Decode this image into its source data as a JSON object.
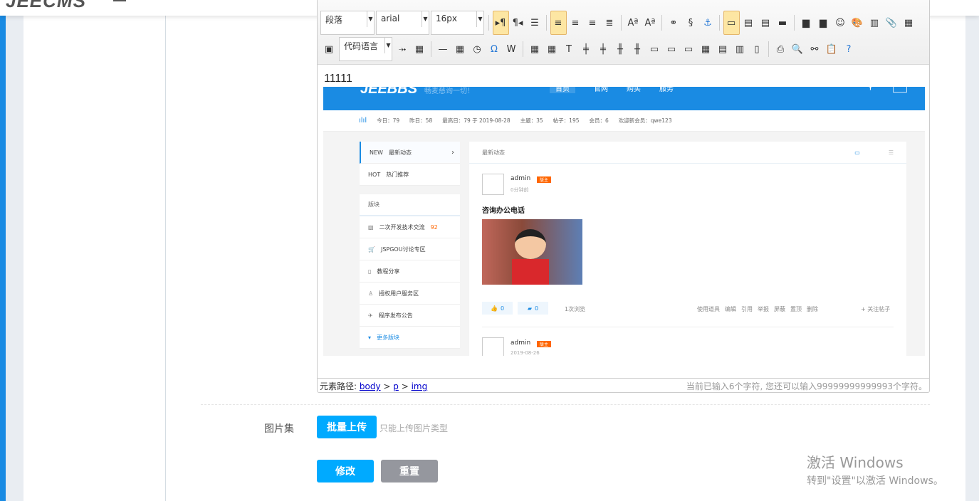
{
  "app": {
    "logo": "JEECMS"
  },
  "editor": {
    "toolbar": {
      "paragraph_select": "段落",
      "font_select": "arial",
      "size_select": "16px",
      "code_lang_select": "代码语言",
      "row1_icons": [
        [
          "ltr-direction-icon",
          "▸¶",
          true
        ],
        [
          "rtl-direction-icon",
          "¶◂",
          false
        ],
        [
          "indent-icon",
          "☰",
          false
        ],
        [
          "sep"
        ],
        [
          "align-left-icon",
          "≡",
          true
        ],
        [
          "align-center-icon",
          "≡",
          false
        ],
        [
          "align-right-icon",
          "≡",
          false
        ],
        [
          "justify-icon",
          "≣",
          false
        ],
        [
          "sep"
        ],
        [
          "to-lowercase-icon",
          "Aª",
          false
        ],
        [
          "to-uppercase-icon",
          "Aª",
          false
        ],
        [
          "sep"
        ],
        [
          "link-icon",
          "⚭",
          false
        ],
        [
          "unlink-icon",
          "§",
          false
        ],
        [
          "anchor-icon",
          "⚓",
          false
        ],
        [
          "sep"
        ],
        [
          "image-none-icon",
          "▭",
          true
        ],
        [
          "image-left-icon",
          "▤",
          false
        ],
        [
          "image-right-icon",
          "▤",
          false
        ],
        [
          "image-center-icon",
          "▬",
          false
        ],
        [
          "sep"
        ],
        [
          "insert-image-icon",
          "▆",
          false
        ],
        [
          "multi-image-icon",
          "▆",
          false
        ],
        [
          "emotion-icon",
          "☺",
          false
        ],
        [
          "scrawl-icon",
          "🎨",
          false
        ],
        [
          "video-icon",
          "▥",
          false
        ],
        [
          "attachment-icon",
          "📎",
          false
        ],
        [
          "map-icon",
          "▦",
          false
        ]
      ],
      "row2_icons_a": [
        [
          "page-break-icon",
          "⤞",
          false
        ],
        [
          "template-icon",
          "▦",
          false
        ],
        [
          "sep"
        ],
        [
          "horizontal-rule-icon",
          "—",
          false
        ],
        [
          "date-icon",
          "▦",
          false
        ],
        [
          "time-icon",
          "◷",
          false
        ],
        [
          "special-char-icon",
          "Ω",
          false
        ],
        [
          "word-image-icon",
          "W",
          false
        ],
        [
          "sep"
        ],
        [
          "insert-table-icon",
          "▦",
          false
        ],
        [
          "delete-table-icon",
          "▦",
          false
        ],
        [
          "table-title-icon",
          "T",
          false
        ],
        [
          "insert-row-icon",
          "╪",
          false
        ],
        [
          "delete-row-icon",
          "╪",
          false
        ],
        [
          "insert-col-icon",
          "╫",
          false
        ],
        [
          "delete-col-icon",
          "╫",
          false
        ],
        [
          "merge-cells-icon",
          "▭",
          false
        ],
        [
          "merge-right-icon",
          "▭",
          false
        ],
        [
          "merge-down-icon",
          "▭",
          false
        ],
        [
          "split-cells-icon",
          "▦",
          false
        ],
        [
          "split-rows-icon",
          "▤",
          false
        ],
        [
          "split-cols-icon",
          "▥",
          false
        ],
        [
          "chart-icon",
          "▯",
          false
        ],
        [
          "sep"
        ],
        [
          "print-icon",
          "⎙",
          false
        ],
        [
          "preview-icon",
          "🔍",
          false
        ],
        [
          "search-replace-icon",
          "⚯",
          false
        ],
        [
          "paste-plain-icon",
          "📋",
          false
        ],
        [
          "help-icon",
          "?",
          false
        ]
      ]
    },
    "content_text": "11111",
    "embedded": {
      "brand": "JEEBBS",
      "slogan": "畅麦慈询一切！",
      "nav": [
        "首页",
        "官网",
        "购买",
        "服务"
      ],
      "stats": [
        "今日：79",
        "昨日：58",
        "最高日：79 于 2019-08-28",
        "主题：35",
        "帖子：195",
        "会员：6",
        "欢迎新会员：qwe123"
      ],
      "tabs": [
        {
          "tag": "NEW",
          "label": "最新动态"
        },
        {
          "tag": "HOT",
          "label": "热门推荐"
        }
      ],
      "boards_title": "版块",
      "boards": [
        {
          "label": "二次开发技术交流",
          "count": "92"
        },
        {
          "label": "JSPGOU讨论专区"
        },
        {
          "label": "教程分享"
        },
        {
          "label": "授权用户服务区"
        },
        {
          "label": "程序发布公告"
        }
      ],
      "more": "更多版块",
      "card_title": "最新动态",
      "post": {
        "author": "admin",
        "badge": "版主",
        "time": "0分钟前",
        "title": "咨询办公电话",
        "likes": "0",
        "comments": "0",
        "views": "1次浏览",
        "actions": [
          "使用道具",
          "编辑",
          "引用",
          "举报",
          "屏蔽",
          "置顶",
          "删除"
        ],
        "follow": "+ 关注帖子"
      },
      "post2": {
        "author": "admin",
        "badge": "版主",
        "time": "2019-08-26"
      }
    },
    "status": {
      "path_label": "元素路径:",
      "path": [
        "body",
        "p",
        "img"
      ],
      "count_text": "当前已输入6个字符, 您还可以输入99999999999993个字符。"
    }
  },
  "form": {
    "gallery_label": "图片集",
    "batch_upload": "批量上传",
    "upload_hint": "只能上传图片类型",
    "submit": "修改",
    "reset": "重置"
  },
  "watermark": {
    "line1": "激活 Windows",
    "line2": "转到\"设置\"以激活 Windows。"
  },
  "colors": {
    "primary": "#00aaff",
    "sidebar": "#1a8be3",
    "reset": "#95979e"
  }
}
